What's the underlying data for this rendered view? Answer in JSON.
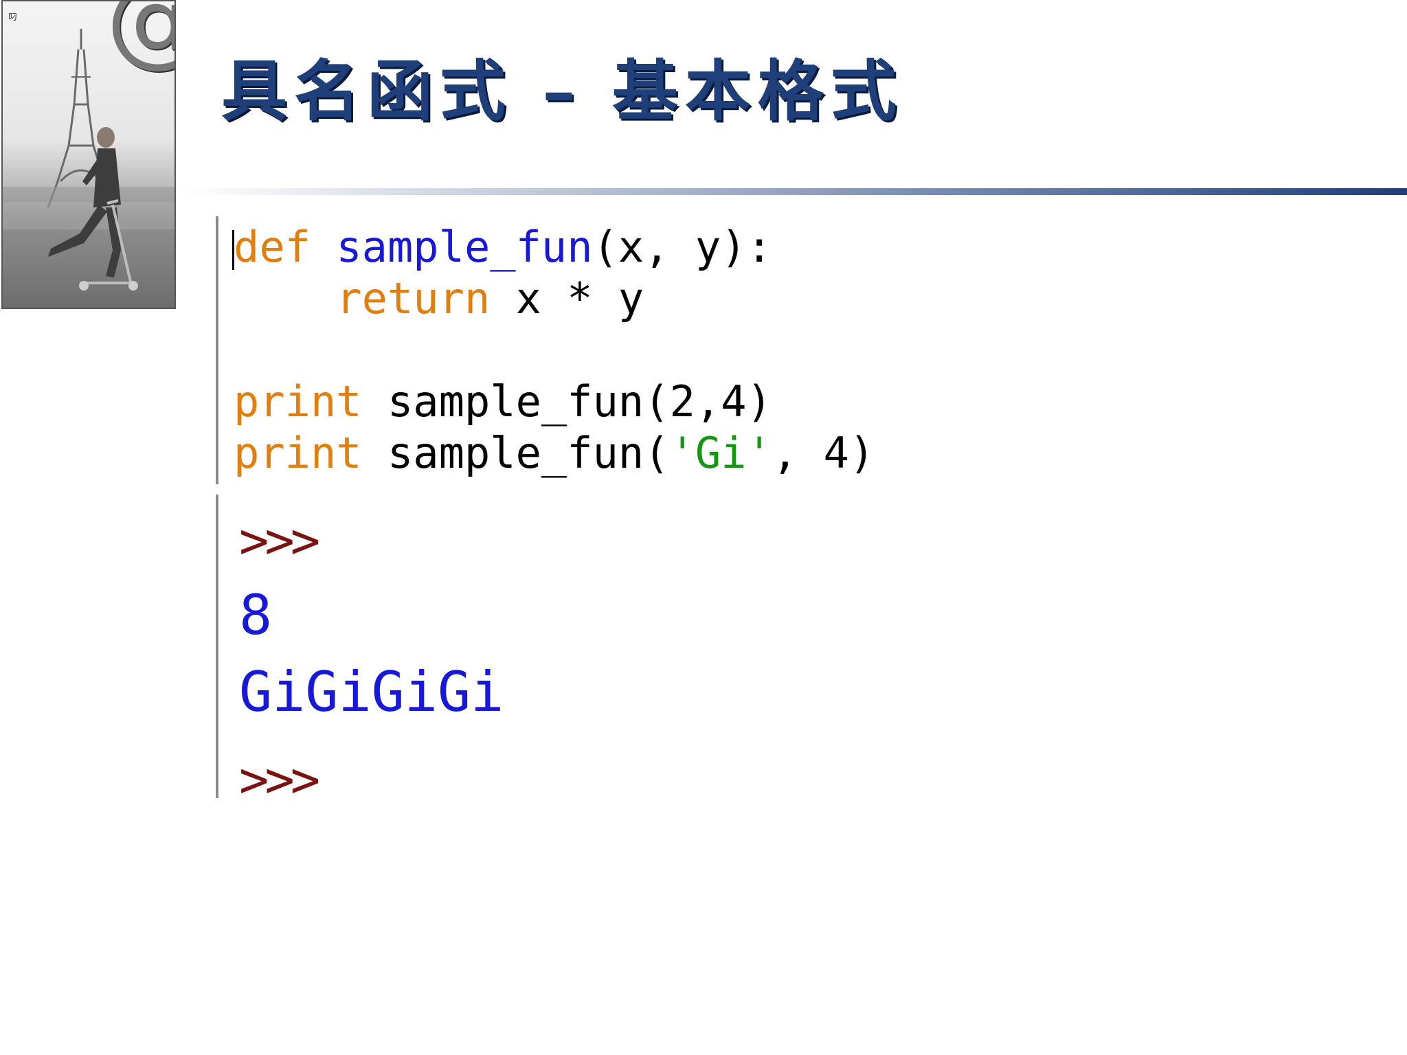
{
  "title": "具名函式 – 基本格式",
  "photo": {
    "at_symbol": "@",
    "stamp": "叼"
  },
  "code": {
    "line1": {
      "kw": "def",
      "name": "sample_fun",
      "args": "(x, y):"
    },
    "line2": {
      "kw": "return",
      "expr": "x * y"
    },
    "line3": {
      "kw": "print",
      "call": "sample_fun(2,4)"
    },
    "line4": {
      "kw": "print",
      "call_start": "sample_fun(",
      "str": "'Gi'",
      "call_end": ", 4)"
    }
  },
  "shell": {
    "prompt_1": ">>>",
    "output_1": "8",
    "output_2": "GiGiGiGi",
    "prompt_2": ">>>"
  },
  "colors": {
    "title": "#1f3f7a",
    "keyword": "#e07f10",
    "function_name": "#1818d8",
    "string": "#119911",
    "prompt": "#7a1212",
    "output": "#1818d8"
  }
}
